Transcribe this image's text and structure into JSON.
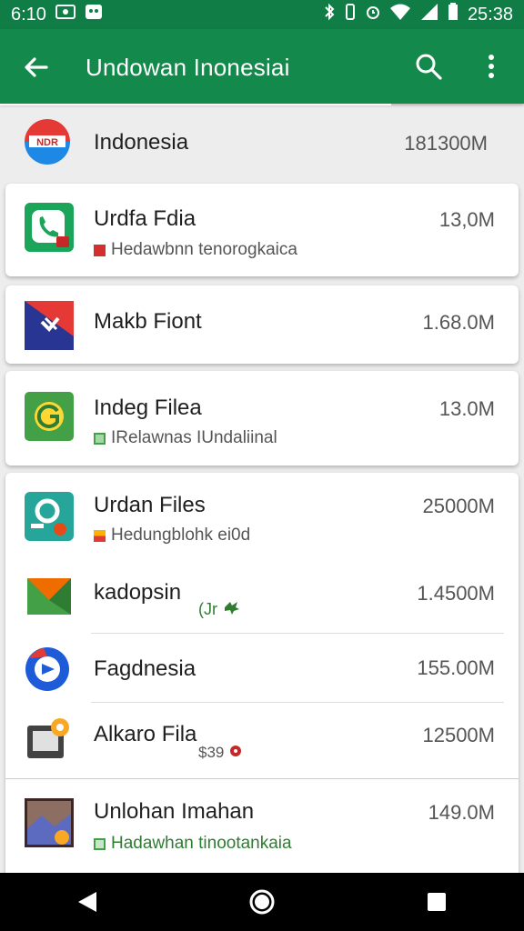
{
  "status_bar": {
    "time_left": "6:10",
    "time_right": "25:38",
    "icons": [
      "photo-icon",
      "notification-icon",
      "bluetooth-icon",
      "vibrate-icon",
      "alarm-icon",
      "wifi-icon",
      "signal-icon",
      "battery-icon"
    ]
  },
  "app_bar": {
    "title": "Undowan Inonesiai",
    "back_icon": "arrow-back-icon",
    "search_icon": "search-icon",
    "more_icon": "more-vert-icon",
    "color": "#138a4c"
  },
  "items": [
    {
      "name": "Indonesia",
      "size": "181300M",
      "subtitle": "",
      "icon": "indonesia-flag-icon"
    },
    {
      "name": "Urdfa Fdia",
      "size": "13,0M",
      "subtitle": "Hedawbnn tenorogkaica",
      "icon": "phone-app-icon",
      "badge_color": "#d32f2f"
    },
    {
      "name": "Makb Fiont",
      "size": "1.68.0M",
      "subtitle": "",
      "icon": "mail-app-icon"
    },
    {
      "name": "Indeg Filea",
      "size": "13.0M",
      "subtitle": "IRelawnas IUndaliinal",
      "icon": "g-app-icon",
      "badge_color": "#43a047"
    },
    {
      "name": "Urdan Files",
      "size": "25000M",
      "subtitle": "Hedungblohk ei0d",
      "icon": "files-app-icon",
      "badge_color": "#e53935"
    },
    {
      "name": "kadopsin",
      "size": "1.4500M",
      "subtitle": "(Jr",
      "icon": "play-app-icon",
      "badge_color": "#2e7d32"
    },
    {
      "name": "Fagdnesia",
      "size": "155.00M",
      "subtitle": "",
      "icon": "maps-app-icon"
    },
    {
      "name": "Alkaro Fila",
      "size": "12500M",
      "subtitle": "$39",
      "icon": "slides-app-icon",
      "badge_color": "#c62828"
    },
    {
      "name": "Unlohan Imahan",
      "size": "149.0M",
      "subtitle": "Hadawhan tinootankaia",
      "icon": "photo-app-icon",
      "badge_color": "#43a047"
    }
  ],
  "nav_bar": {
    "back": "nav-back-icon",
    "home": "nav-home-icon",
    "recents": "nav-recents-icon"
  }
}
